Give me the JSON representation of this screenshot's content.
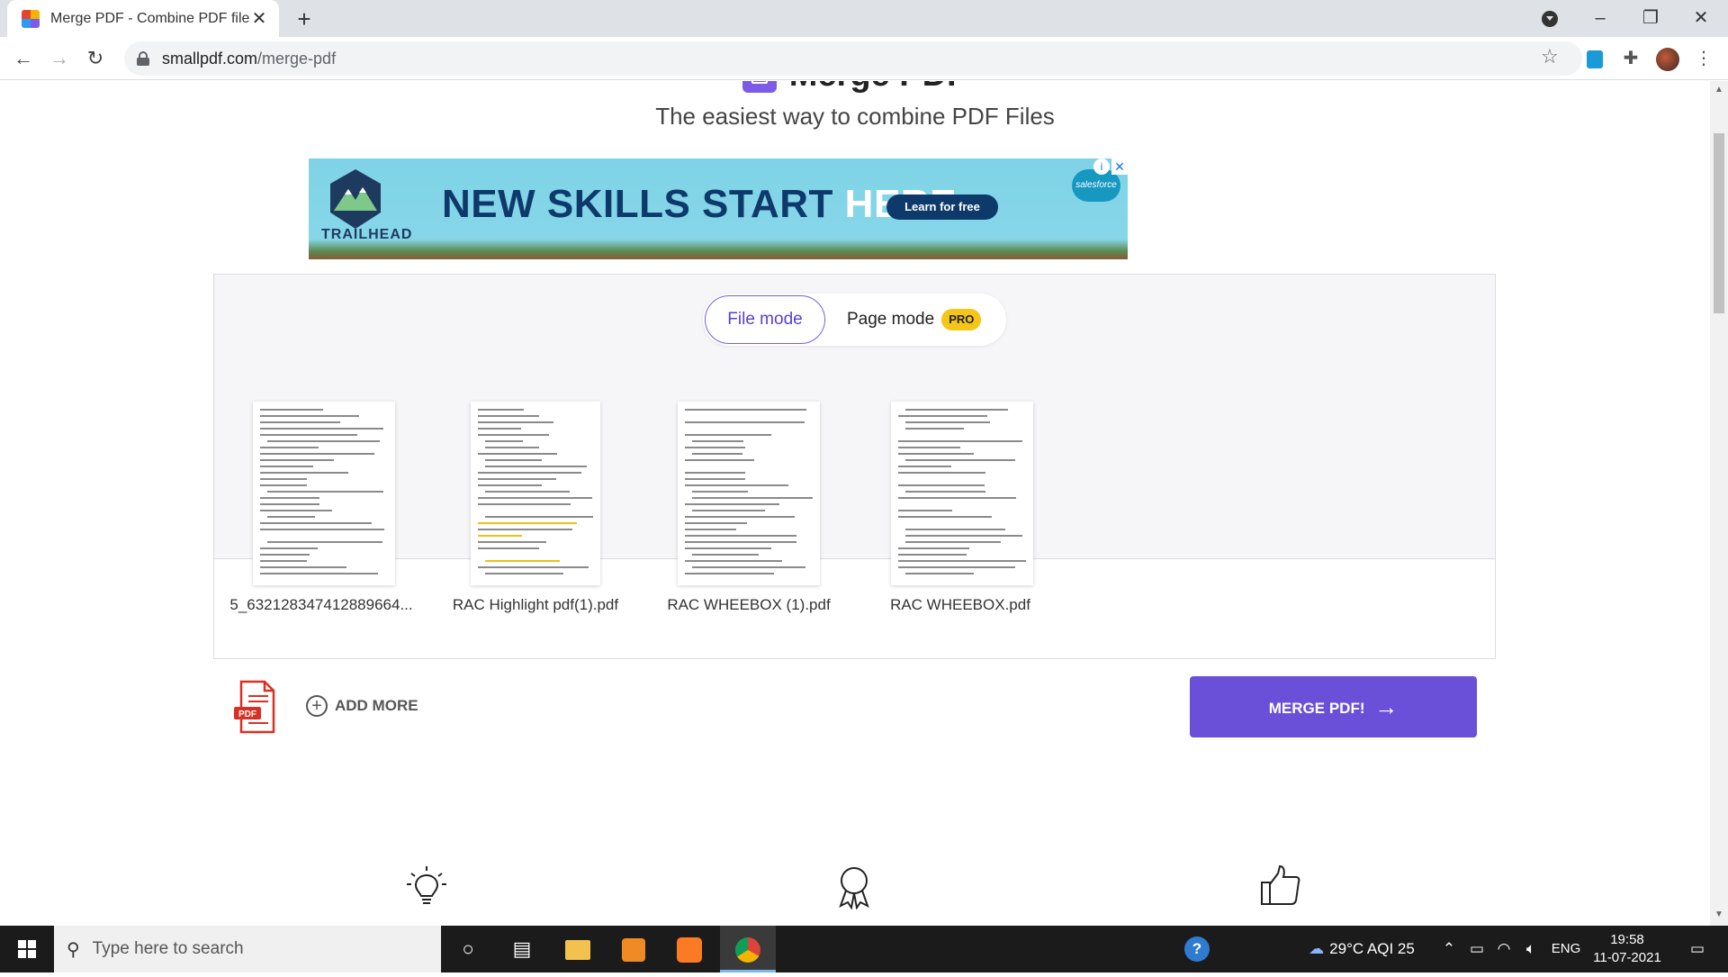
{
  "browser": {
    "tab_title": "Merge PDF - Combine PDF files o",
    "url_host": "smallpdf.com",
    "url_path": "/merge-pdf"
  },
  "page": {
    "title": "Merge PDF",
    "subtitle": "The easiest way to combine PDF Files"
  },
  "ad": {
    "brand": "TRAILHEAD",
    "headline_a": "NEW SKILLS START ",
    "headline_b": "HERE.",
    "cta": "Learn for free",
    "sponsor": "salesforce"
  },
  "modes": {
    "file_mode": "File mode",
    "page_mode": "Page mode",
    "pro_badge": "PRO"
  },
  "files": [
    {
      "name": "5_632128347412889664..."
    },
    {
      "name": "RAC Highlight pdf(1).pdf"
    },
    {
      "name": "RAC WHEEBOX (1).pdf"
    },
    {
      "name": "RAC WHEEBOX.pdf"
    }
  ],
  "actions": {
    "add_more": "ADD MORE",
    "merge": "MERGE PDF!",
    "pdf_icon_text": "PDF"
  },
  "taskbar": {
    "search_placeholder": "Type here to search",
    "weather": "29°C  AQI 25",
    "lang": "ENG",
    "time": "19:58",
    "date": "11-07-2021"
  }
}
